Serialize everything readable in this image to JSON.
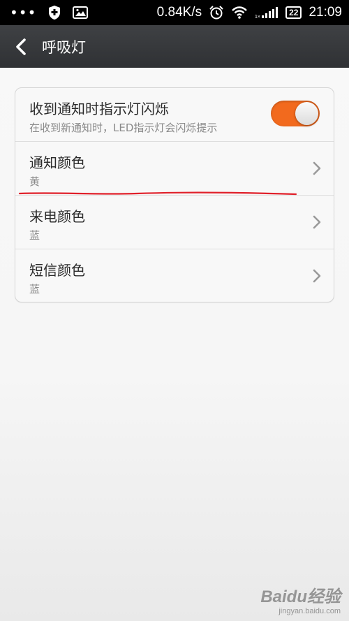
{
  "status_bar": {
    "speed": "0.84K/s",
    "battery": "22",
    "time": "21:09",
    "icons": [
      "more-dots-icon",
      "shield-icon",
      "image-icon",
      "alarm-icon",
      "wifi-icon",
      "signal-icon",
      "battery-icon"
    ]
  },
  "header": {
    "title": "呼吸灯"
  },
  "settings": {
    "notify_blink": {
      "title": "收到通知时指示灯闪烁",
      "subtitle": "在收到新通知时，LED指示灯会闪烁提示",
      "enabled": true
    },
    "notify_color": {
      "title": "通知颜色",
      "value": "黄"
    },
    "call_color": {
      "title": "来电颜色",
      "value": "蓝"
    },
    "sms_color": {
      "title": "短信颜色",
      "value": "蓝"
    }
  },
  "colors": {
    "accent": "#f26a1e",
    "annotation": "#e0202a",
    "header": "#35373a"
  },
  "watermark": {
    "logo": "Baidu经验",
    "url": "jingyan.baidu.com"
  }
}
